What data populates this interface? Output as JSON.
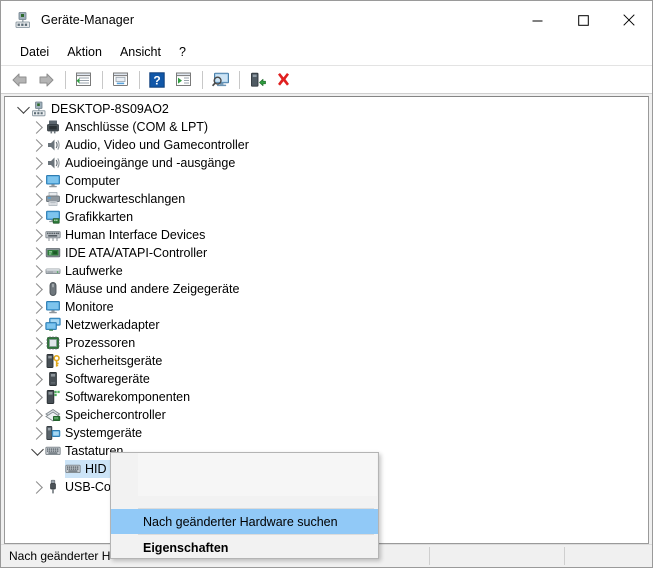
{
  "window": {
    "title": "Geräte-Manager",
    "icon": "device-manager-icon",
    "controls": {
      "minimize": "minimize-icon",
      "maximize": "maximize-icon",
      "close": "close-icon"
    }
  },
  "menubar": {
    "items": [
      {
        "label": "Datei",
        "name": "menu-datei"
      },
      {
        "label": "Aktion",
        "name": "menu-aktion"
      },
      {
        "label": "Ansicht",
        "name": "menu-ansicht"
      },
      {
        "label": "?",
        "name": "menu-hilfe"
      }
    ]
  },
  "toolbar": {
    "buttons": [
      {
        "name": "back-icon"
      },
      {
        "name": "forward-icon"
      },
      {
        "name": "separator"
      },
      {
        "name": "show-hidden-devices-icon"
      },
      {
        "name": "separator"
      },
      {
        "name": "properties-icon"
      },
      {
        "name": "separator"
      },
      {
        "name": "help-icon"
      },
      {
        "name": "update-driver-icon"
      },
      {
        "name": "separator"
      },
      {
        "name": "scan-for-hardware-changes-icon"
      },
      {
        "name": "separator"
      },
      {
        "name": "enable-device-icon"
      },
      {
        "name": "uninstall-device-icon"
      }
    ]
  },
  "tree": {
    "root": {
      "label": "DESKTOP-8S09AO2",
      "icon": "computer-root-icon",
      "expanded": true,
      "level": 0
    },
    "items": [
      {
        "label": "Anschlüsse (COM & LPT)",
        "icon": "ports-icon",
        "level": 1,
        "expandable": true,
        "selected": false
      },
      {
        "label": "Audio, Video und Gamecontroller",
        "icon": "sound-icon",
        "level": 1,
        "expandable": true,
        "selected": false
      },
      {
        "label": "Audioeingänge und -ausgänge",
        "icon": "sound-icon",
        "level": 1,
        "expandable": true,
        "selected": false
      },
      {
        "label": "Computer",
        "icon": "monitor-icon",
        "level": 1,
        "expandable": true,
        "selected": false
      },
      {
        "label": "Druckwarteschlangen",
        "icon": "printer-icon",
        "level": 1,
        "expandable": true,
        "selected": false
      },
      {
        "label": "Grafikkarten",
        "icon": "display-adapter-icon",
        "level": 1,
        "expandable": true,
        "selected": false
      },
      {
        "label": "Human Interface Devices",
        "icon": "hid-icon",
        "level": 1,
        "expandable": true,
        "selected": false
      },
      {
        "label": "IDE ATA/ATAPI-Controller",
        "icon": "ide-controller-icon",
        "level": 1,
        "expandable": true,
        "selected": false
      },
      {
        "label": "Laufwerke",
        "icon": "disk-drive-icon",
        "level": 1,
        "expandable": true,
        "selected": false
      },
      {
        "label": "Mäuse und andere Zeigegeräte",
        "icon": "mouse-icon",
        "level": 1,
        "expandable": true,
        "selected": false
      },
      {
        "label": "Monitore",
        "icon": "monitor-icon",
        "level": 1,
        "expandable": true,
        "selected": false
      },
      {
        "label": "Netzwerkadapter",
        "icon": "network-adapter-icon",
        "level": 1,
        "expandable": true,
        "selected": false
      },
      {
        "label": "Prozessoren",
        "icon": "processor-icon",
        "level": 1,
        "expandable": true,
        "selected": false
      },
      {
        "label": "Sicherheitsgeräte",
        "icon": "security-device-icon",
        "level": 1,
        "expandable": true,
        "selected": false
      },
      {
        "label": "Softwaregeräte",
        "icon": "software-device-icon",
        "level": 1,
        "expandable": true,
        "selected": false
      },
      {
        "label": "Softwarekomponenten",
        "icon": "software-component-icon",
        "level": 1,
        "expandable": true,
        "selected": false
      },
      {
        "label": "Speichercontroller",
        "icon": "storage-controller-icon",
        "level": 1,
        "expandable": true,
        "selected": false
      },
      {
        "label": "Systemgeräte",
        "icon": "system-device-icon",
        "level": 1,
        "expandable": true,
        "selected": false
      },
      {
        "label": "Tastaturen",
        "icon": "keyboard-icon",
        "level": 1,
        "expandable": true,
        "expanded": true,
        "selected": false
      },
      {
        "label": "HID",
        "icon": "keyboard-icon",
        "level": 2,
        "expandable": false,
        "selected": true
      },
      {
        "label": "USB-Co",
        "icon": "usb-icon",
        "level": 1,
        "expandable": true,
        "selected": false
      }
    ]
  },
  "context_menu": {
    "items": [
      {
        "label": "Nach geänderter Hardware suchen",
        "name": "ctx-scan-hardware",
        "highlighted": true,
        "bold": false
      },
      {
        "label": "Eigenschaften",
        "name": "ctx-properties",
        "highlighted": false,
        "bold": true
      }
    ]
  },
  "statusbar": {
    "text": "Nach geänderter H",
    "panels": 3
  },
  "colors": {
    "selection_blue": "#cce4f7",
    "menu_highlight_blue": "#91c9f7",
    "window_chrome": "#f0f0f0",
    "border_gray": "#9a9a9a",
    "delete_red": "#e81123"
  }
}
